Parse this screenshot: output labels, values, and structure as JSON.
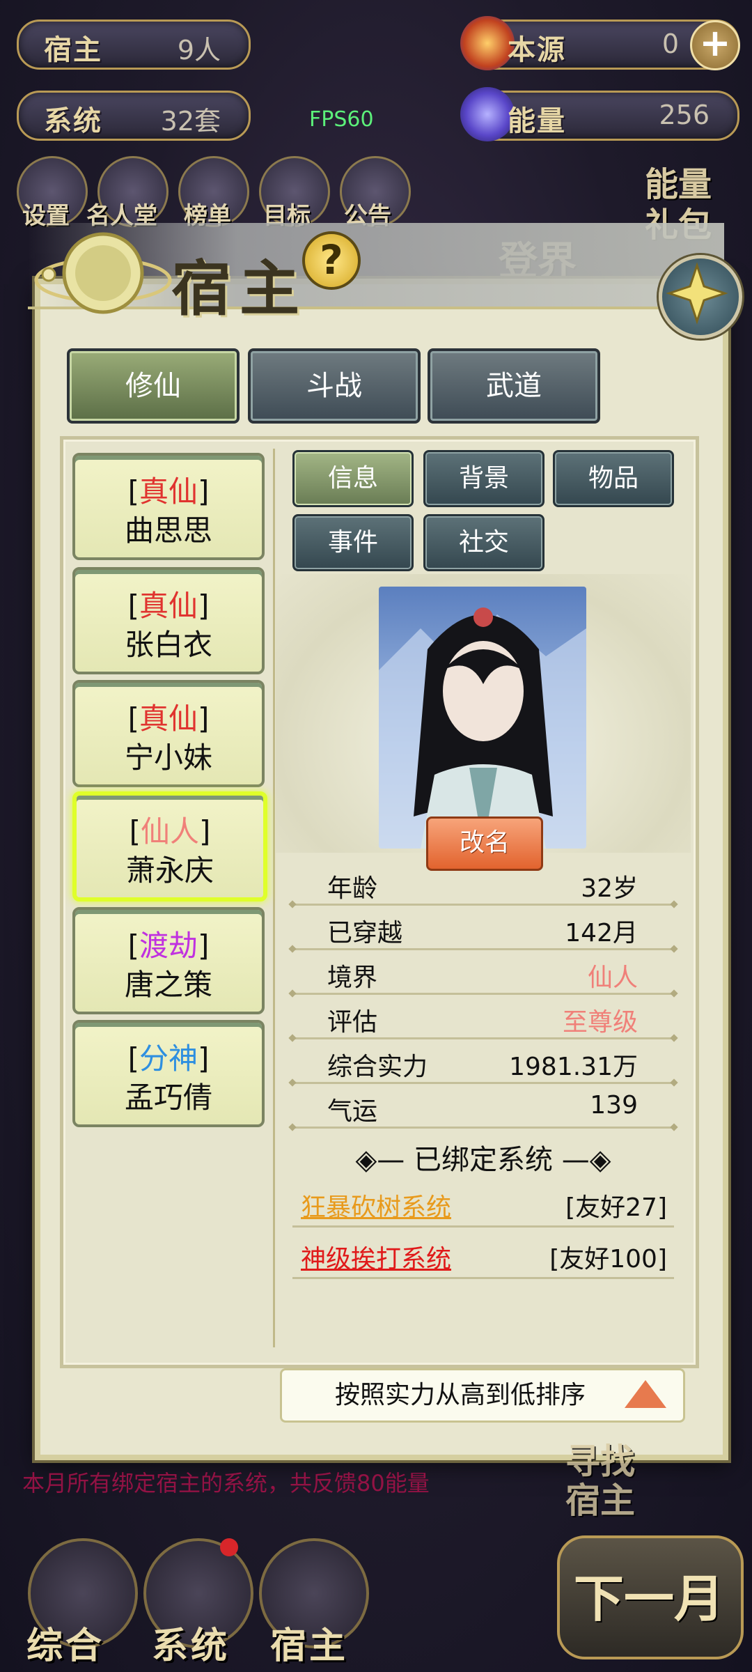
{
  "fps": "FPS60",
  "top_stats": {
    "hosts_label": "宿主",
    "hosts_value": "9人",
    "systems_label": "系统",
    "systems_value": "32套",
    "origin_label": "本源",
    "origin_value": "0",
    "energy_label": "能量",
    "energy_value": "256"
  },
  "top_nav": [
    "设置",
    "名人堂",
    "榜单",
    "目标",
    "公告"
  ],
  "energy_gift": "能量礼包",
  "ascend_label": "登界",
  "modal": {
    "title": "宿主",
    "help_glyph": "?",
    "main_tabs": [
      {
        "label": "修仙",
        "active": true
      },
      {
        "label": "斗战",
        "active": false
      },
      {
        "label": "武道",
        "active": false
      }
    ],
    "hosts": [
      {
        "rank": "真仙",
        "rank_color": "#e0332f",
        "name": "曲思思",
        "selected": false
      },
      {
        "rank": "真仙",
        "rank_color": "#e0332f",
        "name": "张白衣",
        "selected": false
      },
      {
        "rank": "真仙",
        "rank_color": "#e0332f",
        "name": "宁小妹",
        "selected": false
      },
      {
        "rank": "仙人",
        "rank_color": "#f08079",
        "name": "萧永庆",
        "selected": true
      },
      {
        "rank": "渡劫",
        "rank_color": "#c031e0",
        "name": "唐之策",
        "selected": false
      },
      {
        "rank": "分神",
        "rank_color": "#2e8fe0",
        "name": "孟巧倩",
        "selected": false
      }
    ],
    "sub_tabs": [
      {
        "label": "信息",
        "active": true
      },
      {
        "label": "背景",
        "active": false
      },
      {
        "label": "物品",
        "active": false
      },
      {
        "label": "事件",
        "active": false
      },
      {
        "label": "社交",
        "active": false
      }
    ],
    "rename_label": "改名",
    "info": [
      {
        "key": "年龄",
        "value": "32岁",
        "color": "#111111"
      },
      {
        "key": "已穿越",
        "value": "142月",
        "color": "#111111"
      },
      {
        "key": "境界",
        "value": "仙人",
        "color": "#f08079"
      },
      {
        "key": "评估",
        "value": "至尊级",
        "color": "#f08079"
      },
      {
        "key": "综合实力",
        "value": "1981.31万",
        "color": "#111111"
      },
      {
        "key": "气运",
        "value": "139",
        "color": "#111111"
      }
    ],
    "bound_title": "已绑定系统",
    "bound_systems": [
      {
        "name": "狂暴砍树系统",
        "name_color": "#e89a1c",
        "friendship": "[友好27]"
      },
      {
        "name": "神级挨打系统",
        "name_color": "#e01a1a",
        "friendship": "[友好100]"
      }
    ],
    "sort_label": "按照实力从高到低排序"
  },
  "bottom_tip": "本月所有绑定宿主的系统，共反馈80能量",
  "find_host": {
    "line1": "寻找",
    "line2": "宿主"
  },
  "bottom_nav": [
    "综合",
    "系统",
    "宿主"
  ],
  "next_month": "下一月"
}
